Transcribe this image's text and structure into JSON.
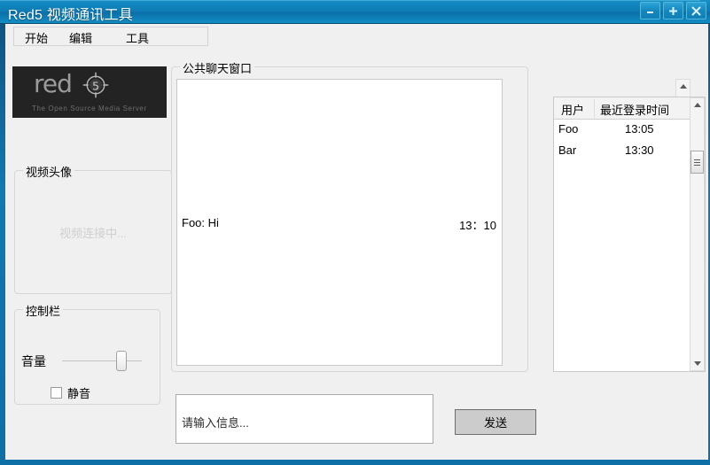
{
  "window": {
    "title": "Red5 视频通讯工具",
    "buttons": {
      "minimize": "minimize-icon",
      "maximize": "maximize-icon",
      "close": "close-icon"
    },
    "accent_color": "#1287bf",
    "client_bg": "#f0f0f0"
  },
  "menubar": {
    "items": [
      {
        "label": "开始"
      },
      {
        "label": "编辑"
      },
      {
        "label": "工具"
      }
    ]
  },
  "logo": {
    "word": "red",
    "digit": "5",
    "tagline": "The Open Source Media Server",
    "bg_color": "#232323",
    "text_color": "#9b9b9b"
  },
  "video": {
    "group_title": "视频头像",
    "status_text": "视频连接中..."
  },
  "control": {
    "group_title": "控制栏",
    "volume_label": "音量",
    "volume_value": 68,
    "mute_label": "静音",
    "mute_checked": false
  },
  "chat": {
    "group_title": "公共聊天窗口",
    "messages": [
      {
        "text": "Foo: Hi",
        "time": "13：10"
      }
    ]
  },
  "userlist": {
    "columns": [
      "用户",
      "最近登录时间"
    ],
    "rows": [
      {
        "name": "Foo",
        "time": "13:05"
      },
      {
        "name": "Bar",
        "time": "13:30"
      }
    ]
  },
  "composer": {
    "placeholder": "请输入信息...",
    "value": "",
    "send_label": "发送"
  },
  "scrollbars": {
    "chat": {
      "name": "chat-scrollbar"
    },
    "users": {
      "name": "userlist-scrollbar"
    }
  }
}
